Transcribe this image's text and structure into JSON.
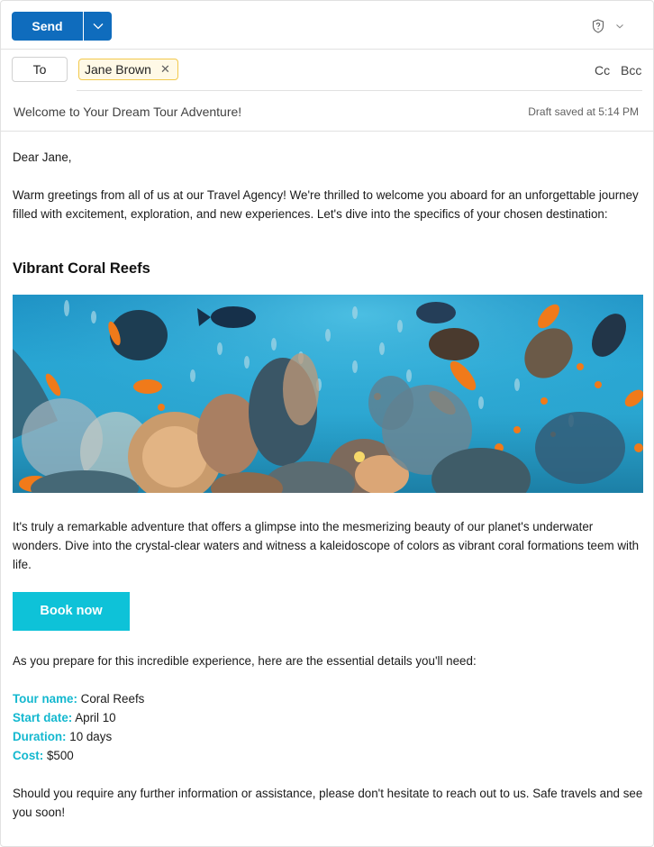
{
  "toolbar": {
    "send_label": "Send",
    "send_options_icon": "chevron-down-icon",
    "sensitivity_icon": "shield-question-icon",
    "more_icon": "chevron-down-icon",
    "accent_color": "#0f6cbd"
  },
  "recipients": {
    "to_label": "To",
    "to_chips": [
      {
        "name": "Jane Brown",
        "remove_icon": "close-icon"
      }
    ],
    "cc_label": "Cc",
    "bcc_label": "Bcc"
  },
  "subject": {
    "value": "Welcome to Your Dream Tour Adventure!",
    "draft_status": "Draft saved at 5:14 PM"
  },
  "message": {
    "greeting": "Dear Jane,",
    "intro": "Warm greetings from all of us at our Travel Agency! We're thrilled to welcome you aboard for an unforgettable journey filled with excitement, exploration, and new experiences. Let's dive into the specifics of your chosen destination:",
    "heading": "Vibrant Coral Reefs",
    "image_alt": "Underwater coral reef with colorful fish",
    "description": "It's truly a remarkable adventure that offers a glimpse into the mesmerizing beauty of our planet's underwater wonders. Dive into the crystal-clear waters and witness a kaleidoscope of colors as vibrant coral formations teem with life.",
    "cta_label": "Book now",
    "cta_color": "#0ec2d8",
    "details_intro": "As you prepare for this incredible experience, here are the essential details you'll need:",
    "details": [
      {
        "label": "Tour name:",
        "value": "Coral Reefs"
      },
      {
        "label": "Start date:",
        "value": "April 10"
      },
      {
        "label": "Duration:",
        "value": "10 days"
      },
      {
        "label": "Cost:",
        "value": "$500"
      }
    ],
    "detail_label_color": "#14b8cf",
    "closing": "Should you require any further information or assistance, please don't hesitate to reach out to us. Safe travels and see you soon!"
  }
}
